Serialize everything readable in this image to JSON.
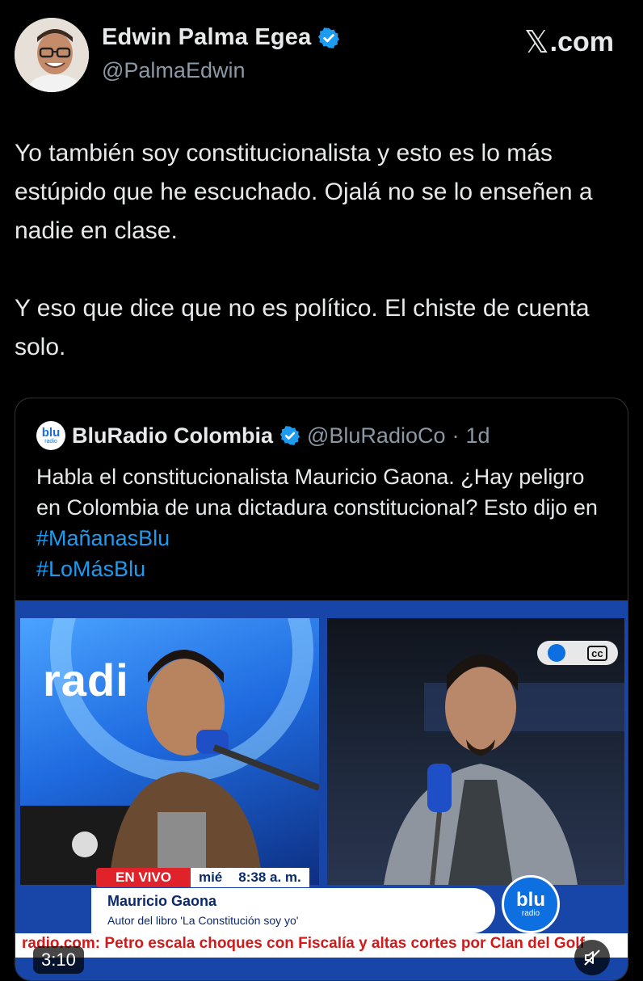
{
  "author": {
    "name": "Edwin Palma Egea",
    "handle": "@PalmaEdwin",
    "verified_icon": "verified-badge-icon",
    "accent": "#1d9bf0"
  },
  "watermark": {
    "label": ".com"
  },
  "tweet": {
    "paragraph_1": "Yo también soy constitucionalista y esto es lo más estúpido que he escuchado. Ojalá no se lo enseñen a nadie en clase.",
    "paragraph_2": "Y eso que dice que no es político. El chiste de cuenta solo."
  },
  "quote": {
    "name": "BluRadio Colombia",
    "handle": "@BluRadioCo",
    "separator": "·",
    "time": "1d",
    "text": "Habla el constitucionalista Mauricio Gaona. ¿Hay peligro en Colombia de una dictadura constitucional? Esto dijo en ",
    "hashtag_1": "#MañanasBlu",
    "hashtag_2": "#LoMásBlu",
    "logo_main": "blu",
    "logo_sub": "radio"
  },
  "video": {
    "studio_word": "radi",
    "live_label": "EN VIVO",
    "day": "mié",
    "clock": "8:38 a. m.",
    "guest_name": "Mauricio Gaona",
    "guest_role": "Autor del libro 'La Constitución soy yo'",
    "ticker": "radio.com:   Petro escala choques con Fiscalía y altas cortes por Clan del Golf",
    "duration": "3:10",
    "mute_icon": "muted-speaker-icon",
    "cc_label": "cc"
  }
}
